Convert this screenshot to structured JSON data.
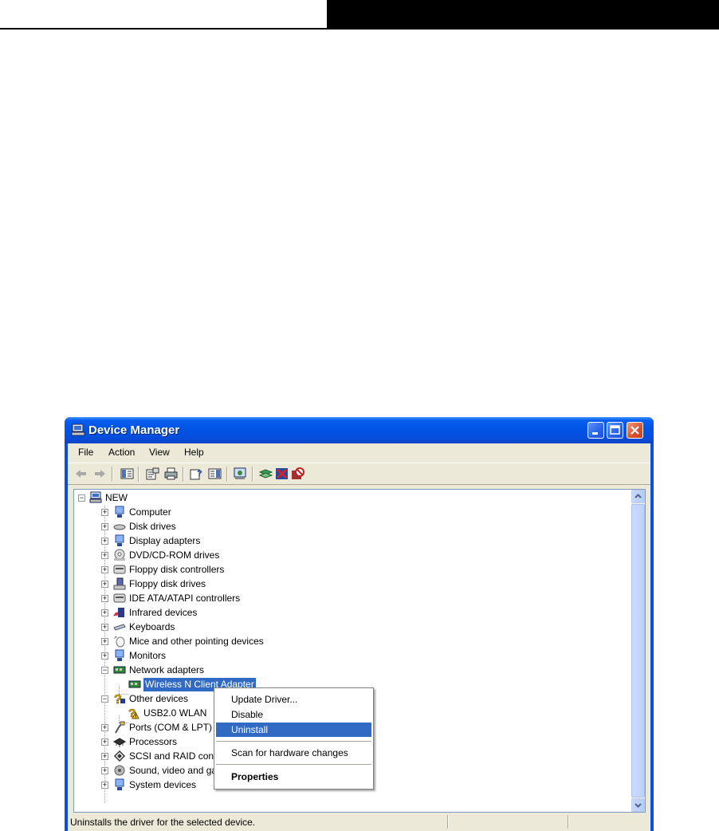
{
  "window": {
    "title": "Device Manager",
    "title_icon": "computer-icon",
    "controls": [
      "minimize",
      "maximize",
      "close"
    ]
  },
  "menu": [
    "File",
    "Action",
    "View",
    "Help"
  ],
  "toolbar_icons": [
    "back-icon",
    "forward-icon",
    "show-hide-console-tree-icon",
    "properties-icon",
    "print-icon",
    "help-icon",
    "show-hide-action-pane-icon",
    "scan-hardware-icon",
    "update-driver-icon",
    "uninstall-icon",
    "disable-icon"
  ],
  "tree": {
    "root": "NEW",
    "items": [
      {
        "label": "Computer",
        "icon": "computer-icon"
      },
      {
        "label": "Disk drives",
        "icon": "disk-drive-icon"
      },
      {
        "label": "Display adapters",
        "icon": "display-adapter-icon"
      },
      {
        "label": "DVD/CD-ROM drives",
        "icon": "cdrom-icon"
      },
      {
        "label": "Floppy disk controllers",
        "icon": "controller-icon"
      },
      {
        "label": "Floppy disk drives",
        "icon": "floppy-icon"
      },
      {
        "label": "IDE ATA/ATAPI controllers",
        "icon": "controller-icon"
      },
      {
        "label": "Infrared devices",
        "icon": "infrared-icon"
      },
      {
        "label": "Keyboards",
        "icon": "keyboard-icon"
      },
      {
        "label": "Mice and other pointing devices",
        "icon": "mouse-icon"
      },
      {
        "label": "Monitors",
        "icon": "monitor-icon"
      },
      {
        "label": "Network adapters",
        "icon": "network-adapter-icon"
      },
      {
        "label": "Wireless N Client Adapter",
        "icon": "network-adapter-icon"
      },
      {
        "label": "Other devices",
        "icon": "unknown-device-icon"
      },
      {
        "label": "USB2.0 WLAN",
        "icon": "warning-device-icon"
      },
      {
        "label": "Ports (COM & LPT)",
        "icon": "port-icon"
      },
      {
        "label": "Processors",
        "icon": "processor-icon"
      },
      {
        "label": "SCSI and RAID controllers",
        "icon": "scsi-icon"
      },
      {
        "label": "Sound, video and game controllers",
        "icon": "sound-icon"
      },
      {
        "label": "System devices",
        "icon": "system-icon"
      }
    ]
  },
  "context_menu": {
    "update_driver": "Update Driver...",
    "disable": "Disable",
    "uninstall": "Uninstall",
    "scan": "Scan for hardware changes",
    "properties": "Properties"
  },
  "status": "Uninstalls the driver for the selected device.",
  "colors": {
    "title_blue": "#0054e3",
    "selection": "#316ac5",
    "face": "#ece9d8"
  }
}
